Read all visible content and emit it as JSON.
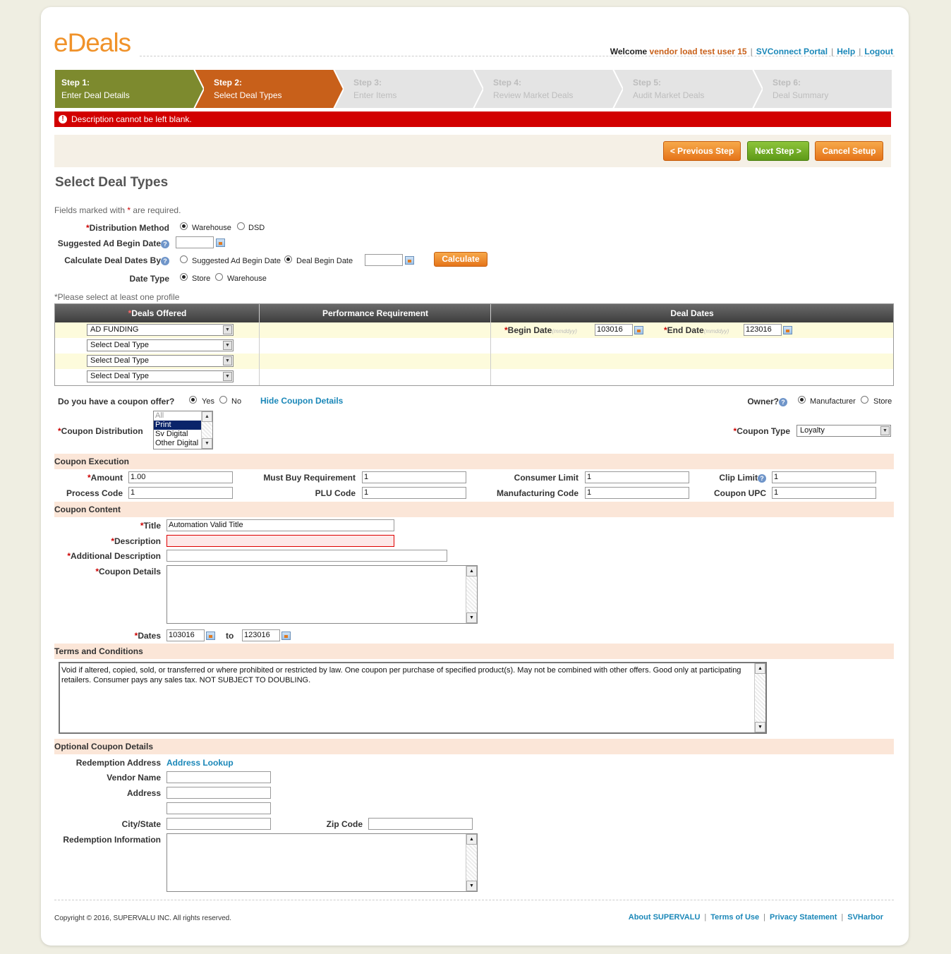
{
  "app": {
    "logo": "eDeals"
  },
  "topnav": {
    "welcome": "Welcome",
    "user": "vendor load test user 15",
    "links": [
      "SVConnect Portal",
      "Help",
      "Logout"
    ]
  },
  "steps": [
    {
      "title": "Step 1:",
      "label": "Enter Deal Details",
      "state": "done",
      "color": "#7d8a2e"
    },
    {
      "title": "Step 2:",
      "label": "Select Deal Types",
      "state": "current",
      "color": "#c8601a"
    },
    {
      "title": "Step 3:",
      "label": "Enter Items",
      "state": "pending",
      "color": "#e4e4e4"
    },
    {
      "title": "Step 4:",
      "label": "Review Market Deals",
      "state": "pending",
      "color": "#e4e4e4"
    },
    {
      "title": "Step 5:",
      "label": "Audit Market Deals",
      "state": "pending",
      "color": "#e4e4e4"
    },
    {
      "title": "Step 6:",
      "label": "Deal Summary",
      "state": "pending",
      "color": "#e4e4e4"
    }
  ],
  "error": {
    "message": "Description cannot be left blank."
  },
  "buttons": {
    "previous": "< Previous Step",
    "next": "Next Step >",
    "cancel": "Cancel Setup",
    "calculate": "Calculate"
  },
  "page": {
    "title": "Select Deal Types",
    "required_prefix": "Fields marked with",
    "required_star": "*",
    "required_suffix": "are required."
  },
  "form": {
    "distribution_method": {
      "label": "Distribution Method",
      "options": [
        "Warehouse",
        "DSD"
      ],
      "selected": "Warehouse"
    },
    "suggested_ad_begin_date": {
      "label": "Suggested Ad Begin Date",
      "value": ""
    },
    "calc_deal_dates_by": {
      "label": "Calculate Deal Dates By",
      "options": [
        "Suggested Ad Begin Date",
        "Deal Begin Date"
      ],
      "selected": "Deal Begin Date",
      "value": ""
    },
    "date_type": {
      "label": "Date Type",
      "options": [
        "Store",
        "Warehouse"
      ],
      "selected": "Store"
    }
  },
  "profile_note": "*Please select at least one profile",
  "deals_table": {
    "headers": [
      "Deals Offered",
      "Performance Requirement",
      "Deal Dates"
    ],
    "rows": [
      "AD FUNDING",
      "Select Deal Type",
      "Select Deal Type",
      "Select Deal Type"
    ],
    "begin_date": {
      "label": "Begin Date",
      "hint": "(mmddyy)",
      "value": "103016"
    },
    "end_date": {
      "label": "End Date",
      "hint": "(mmddyy)",
      "value": "123016"
    }
  },
  "coupon": {
    "offer_question": "Do you have a coupon offer?",
    "offer_options": [
      "Yes",
      "No"
    ],
    "offer_selected": "Yes",
    "hide_link": "Hide Coupon Details",
    "owner_label": "Owner?",
    "owner_options": [
      "Manufacturer",
      "Store"
    ],
    "owner_selected": "Manufacturer",
    "distribution_label": "Coupon Distribution",
    "distribution_items": [
      "All",
      "Print",
      "Sv Digital",
      "Other Digital"
    ],
    "distribution_selected": "Print",
    "type_label": "Coupon Type",
    "type_value": "Loyalty"
  },
  "execution": {
    "section": "Coupon Execution",
    "amount": {
      "label": "Amount",
      "value": "1.00"
    },
    "must_buy": {
      "label": "Must Buy Requirement",
      "value": "1"
    },
    "consumer_limit": {
      "label": "Consumer Limit",
      "value": "1"
    },
    "clip_limit": {
      "label": "Clip Limit",
      "value": "1"
    },
    "process_code": {
      "label": "Process Code",
      "value": "1"
    },
    "plu_code": {
      "label": "PLU Code",
      "value": "1"
    },
    "manufacturing_code": {
      "label": "Manufacturing Code",
      "value": "1"
    },
    "coupon_upc": {
      "label": "Coupon UPC",
      "value": "1"
    }
  },
  "content": {
    "section": "Coupon Content",
    "title": {
      "label": "Title",
      "value": "Automation Valid Title"
    },
    "description": {
      "label": "Description",
      "value": ""
    },
    "additional_description": {
      "label": "Additional Description",
      "value": ""
    },
    "coupon_details": {
      "label": "Coupon Details",
      "value": ""
    },
    "dates": {
      "label": "Dates",
      "from": "103016",
      "to_label": "to",
      "to": "123016"
    }
  },
  "terms": {
    "section": "Terms and Conditions",
    "text": "Void if altered, copied, sold, or transferred or where prohibited or restricted by law. One coupon per purchase of specified product(s). May not be combined with other offers. Good only at participating retailers. Consumer pays any sales tax. NOT SUBJECT TO DOUBLING."
  },
  "optional": {
    "section": "Optional Coupon Details",
    "redemption_address": "Redemption Address",
    "address_lookup": "Address Lookup",
    "vendor_name": "Vendor Name",
    "address": "Address",
    "city_state": "City/State",
    "zip_code": "Zip Code",
    "redemption_info": "Redemption Information"
  },
  "footer": {
    "copyright": "Copyright © 2016, SUPERVALU INC. All rights reserved.",
    "links": [
      "About SUPERVALU",
      "Terms of Use",
      "Privacy Statement",
      "SVHarbor"
    ]
  }
}
